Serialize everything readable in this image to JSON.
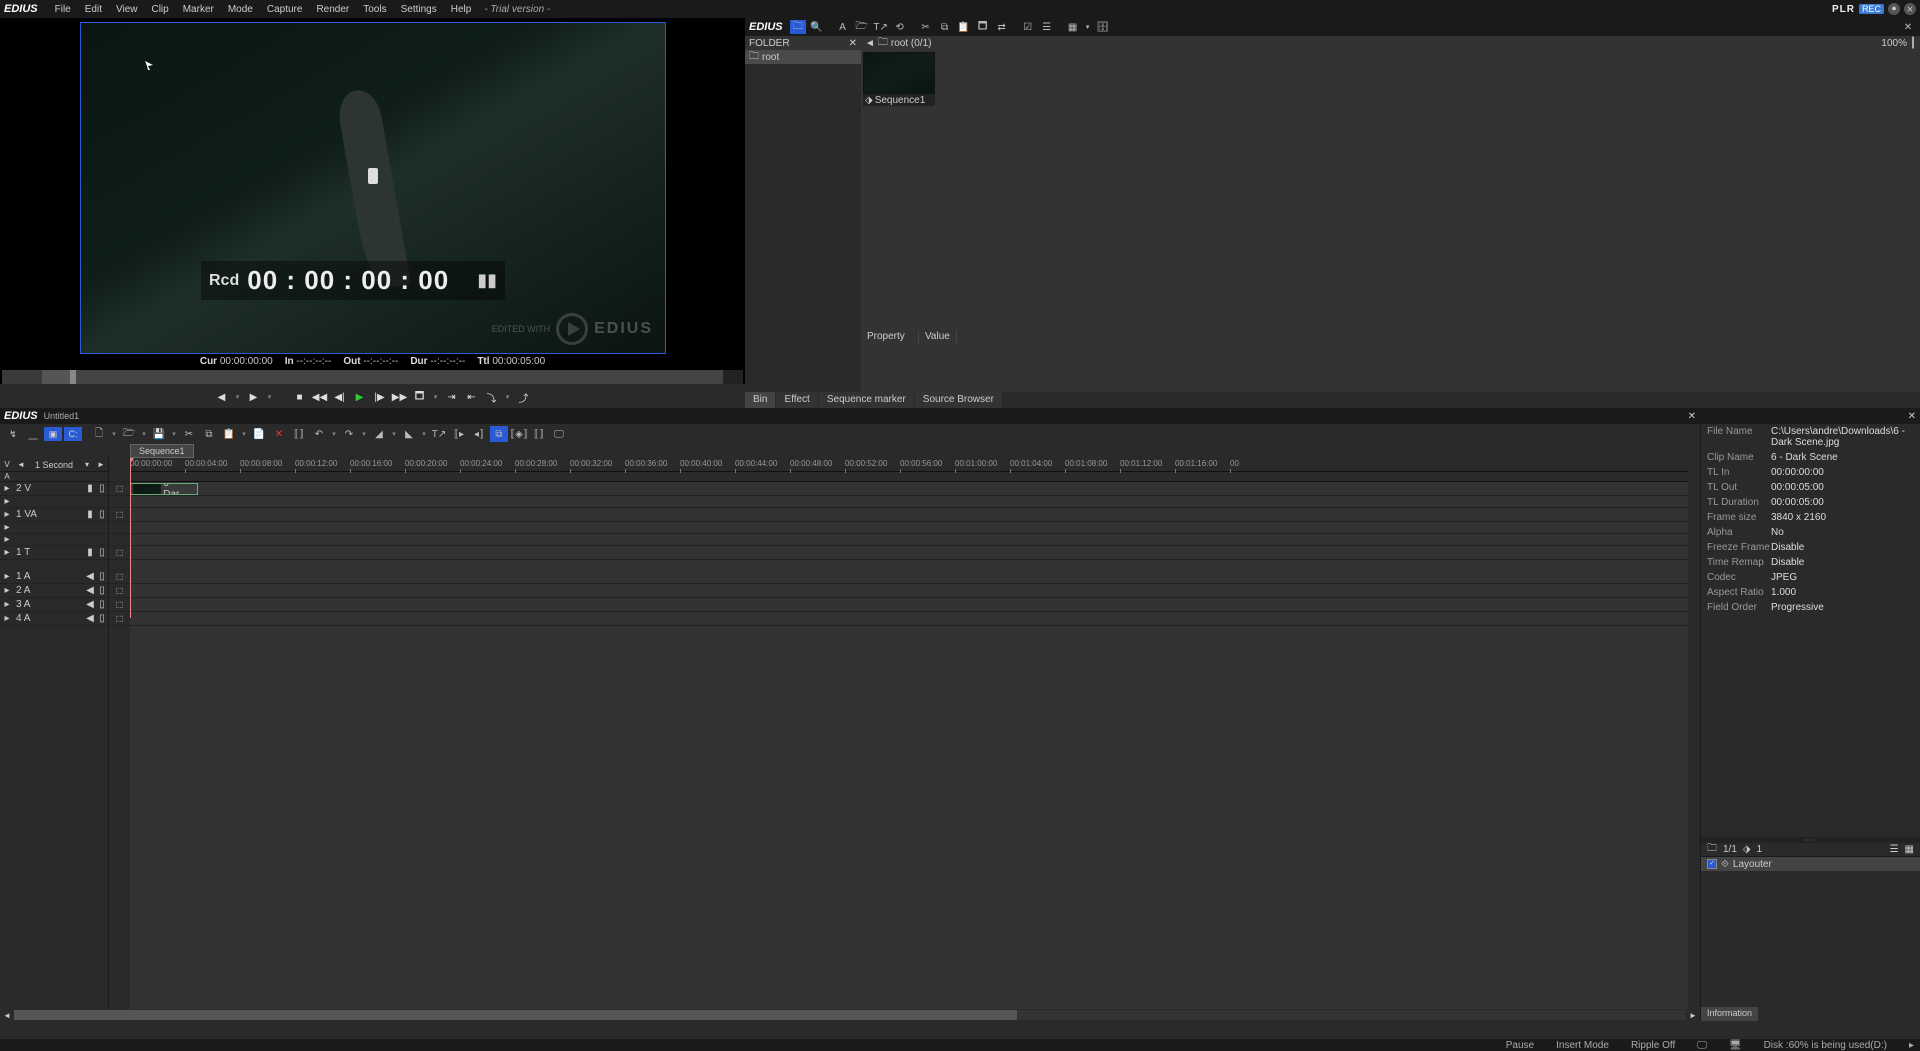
{
  "app": {
    "logo": "EDIUS",
    "menus": [
      "File",
      "Edit",
      "View",
      "Clip",
      "Marker",
      "Mode",
      "Capture",
      "Render",
      "Tools",
      "Settings",
      "Help"
    ],
    "trial": "- Trial version -",
    "rec_prefix": "PLR",
    "rec_badge": "REC"
  },
  "preview": {
    "rcd_label": "Rcd",
    "rcd_tc": "00 : 00 : 00 : 00",
    "watermark_pre": "EDITED WITH",
    "watermark_brand": "EDIUS",
    "tc": {
      "cur_l": "Cur",
      "cur": "00:00:00:00",
      "in_l": "In",
      "in": "--:--:--:--",
      "out_l": "Out",
      "out": "--:--:--:--",
      "dur_l": "Dur",
      "dur": "--:--:--:--",
      "ttl_l": "Ttl",
      "ttl": "00:00:05:00"
    }
  },
  "bin": {
    "folder_hdr": "FOLDER",
    "root_folder": "root",
    "crumb": "root (0/1)",
    "zoom": "100%",
    "thumb_name": "Sequence1",
    "prop_col1": "Property",
    "prop_col2": "Value",
    "tabs": [
      "Bin",
      "Effect",
      "Sequence marker",
      "Source Browser"
    ]
  },
  "timeline": {
    "project": "Untitled1",
    "seq_tab": "Sequence1",
    "scale": "1 Second",
    "ruler": [
      "00:00:00:00",
      "00:00:04:00",
      "00:00:08:00",
      "00:00:12:00",
      "00:00:16:00",
      "00:00:20:00",
      "00:00:24:00",
      "00:00:28:00",
      "00:00:32:00",
      "00:00:36:00",
      "00:00:40:00",
      "00:00:44:00",
      "00:00:48:00",
      "00:00:52:00",
      "00:00:56:00",
      "00:01:00:00",
      "00:01:04:00",
      "00:01:08:00",
      "00:01:12:00",
      "00:01:16:00",
      "00"
    ],
    "tracks": [
      "2 V",
      "1 VA",
      "1 T",
      "1 A",
      "2 A",
      "3 A",
      "4 A"
    ],
    "clip_name": "6 - Dar…"
  },
  "info": {
    "rows": [
      {
        "k": "File Name",
        "v": "C:\\Users\\andre\\Downloads\\6 - Dark Scene.jpg"
      },
      {
        "k": "Clip Name",
        "v": "6 - Dark Scene"
      },
      {
        "k": "TL In",
        "v": "00:00:00:00"
      },
      {
        "k": "TL Out",
        "v": "00:00:05:00"
      },
      {
        "k": "TL Duration",
        "v": "00:00:05:00"
      },
      {
        "k": "Frame size",
        "v": "3840 x 2160"
      },
      {
        "k": "Alpha",
        "v": "No"
      },
      {
        "k": "Freeze Frame",
        "v": "Disable"
      },
      {
        "k": "Time Remap",
        "v": "Disable"
      },
      {
        "k": "Codec",
        "v": "JPEG"
      },
      {
        "k": "Aspect Ratio",
        "v": "1.000"
      },
      {
        "k": "Field Order",
        "v": "Progressive"
      }
    ],
    "count": "1/1",
    "fx_count": "1",
    "fx_item": "Layouter",
    "tab": "Information"
  },
  "status": {
    "pause": "Pause",
    "insert": "Insert Mode",
    "ripple": "Ripple Off",
    "disk": "Disk :60% is being used(D:)"
  }
}
